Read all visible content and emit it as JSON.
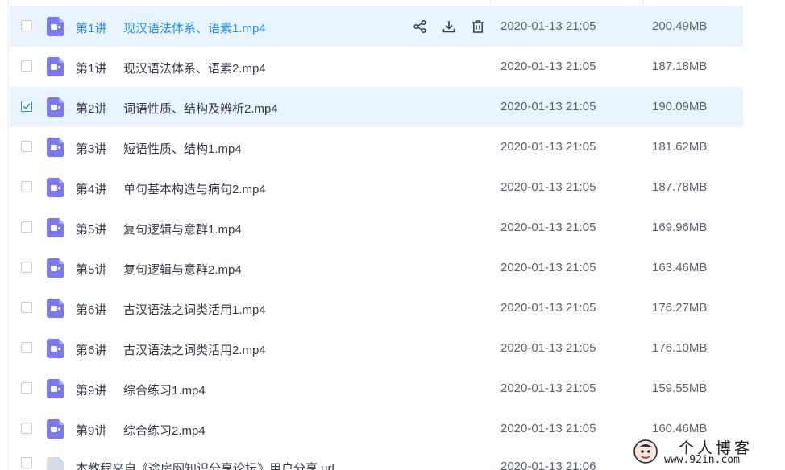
{
  "files": [
    {
      "lecture": "第1讲",
      "title": "现汉语法体系、语素1.mp4",
      "date": "2020-01-13 21:05",
      "size": "200.49MB",
      "state": "hover",
      "type": "video"
    },
    {
      "lecture": "第1讲",
      "title": "现汉语法体系、语素2.mp4",
      "date": "2020-01-13 21:05",
      "size": "187.18MB",
      "state": "normal",
      "type": "video"
    },
    {
      "lecture": "第2讲",
      "title": "词语性质、结构及辨析2.mp4",
      "date": "2020-01-13 21:05",
      "size": "190.09MB",
      "state": "selected",
      "type": "video"
    },
    {
      "lecture": "第3讲",
      "title": "短语性质、结构1.mp4",
      "date": "2020-01-13 21:05",
      "size": "181.62MB",
      "state": "normal",
      "type": "video"
    },
    {
      "lecture": "第4讲",
      "title": "单句基本构造与病句2.mp4",
      "date": "2020-01-13 21:05",
      "size": "187.78MB",
      "state": "normal",
      "type": "video"
    },
    {
      "lecture": "第5讲",
      "title": "复句逻辑与意群1.mp4",
      "date": "2020-01-13 21:05",
      "size": "169.96MB",
      "state": "normal",
      "type": "video"
    },
    {
      "lecture": "第5讲",
      "title": "复句逻辑与意群2.mp4",
      "date": "2020-01-13 21:05",
      "size": "163.46MB",
      "state": "normal",
      "type": "video"
    },
    {
      "lecture": "第6讲",
      "title": "古汉语法之词类活用1.mp4",
      "date": "2020-01-13 21:05",
      "size": "176.27MB",
      "state": "normal",
      "type": "video"
    },
    {
      "lecture": "第6讲",
      "title": "古汉语法之词类活用2.mp4",
      "date": "2020-01-13 21:05",
      "size": "176.10MB",
      "state": "normal",
      "type": "video"
    },
    {
      "lecture": "第9讲",
      "title": "综合练习1.mp4",
      "date": "2020-01-13 21:05",
      "size": "159.55MB",
      "state": "normal",
      "type": "video"
    },
    {
      "lecture": "第9讲",
      "title": "综合练习2.mp4",
      "date": "2020-01-13 21:05",
      "size": "160.46MB",
      "state": "normal",
      "type": "video"
    },
    {
      "lecture": "",
      "title": "本教程来自《途房网知识分享论坛》用户分享.url",
      "date": "2020-01-13 21:06",
      "size": "",
      "state": "partial",
      "type": "doc"
    }
  ],
  "row_actions": [
    {
      "name": "share-icon",
      "label": "share"
    },
    {
      "name": "download-icon",
      "label": "download"
    },
    {
      "name": "delete-icon",
      "label": "delete"
    }
  ],
  "watermark": {
    "title": "个人博客",
    "url": "www.92in.com"
  },
  "colors": {
    "accent": "#1e8ff7",
    "row_highlight": "#eaf4fe",
    "video_icon": "#7b79f0",
    "text": "#333a46",
    "muted_text": "#5a616d"
  }
}
